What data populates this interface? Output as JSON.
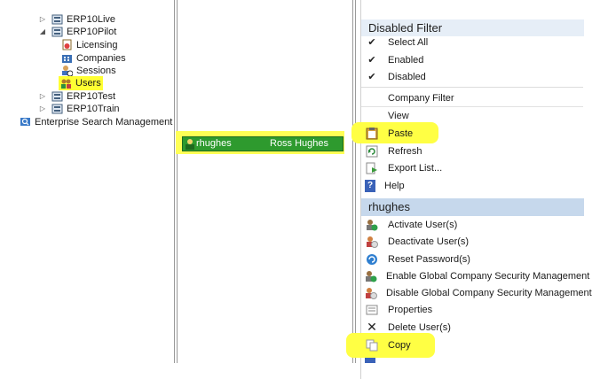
{
  "tree": {
    "items": [
      {
        "label": "ERP10Live",
        "expander": "▷"
      },
      {
        "label": "ERP10Pilot",
        "expander": "◢"
      },
      {
        "label": "Licensing"
      },
      {
        "label": "Companies"
      },
      {
        "label": "Sessions"
      },
      {
        "label": "Users"
      },
      {
        "label": "ERP10Test",
        "expander": "▷"
      },
      {
        "label": "ERP10Train",
        "expander": "▷"
      },
      {
        "label": "Enterprise Search Management"
      }
    ]
  },
  "users_list": {
    "row": {
      "login": "rhughes",
      "name": "Ross Hughes"
    }
  },
  "context_menu": {
    "filter_header": "Disabled Filter",
    "filter_items": [
      {
        "label": "Select All",
        "checked": "✔"
      },
      {
        "label": "Enabled",
        "checked": "✔"
      },
      {
        "label": "Disabled",
        "checked": "✔"
      }
    ],
    "general_items": [
      {
        "label": "Company Filter"
      },
      {
        "label": "View"
      },
      {
        "label": "Paste",
        "icon": "clipboard-icon"
      },
      {
        "label": "Refresh",
        "icon": "refresh-icon"
      },
      {
        "label": "Export List...",
        "icon": "export-icon"
      },
      {
        "label": "Help",
        "icon": "help-icon",
        "glyph": "?"
      }
    ],
    "user_header": "rhughes",
    "user_items": [
      {
        "label": "Activate User(s)",
        "icon": "activate-user-icon"
      },
      {
        "label": "Deactivate User(s)",
        "icon": "deactivate-user-icon"
      },
      {
        "label": "Reset Password(s)",
        "icon": "reset-password-icon"
      },
      {
        "label": "Enable Global Company Security Management",
        "icon": "enable-security-icon"
      },
      {
        "label": "Disable Global Company Security Management",
        "icon": "disable-security-icon"
      },
      {
        "label": "Properties",
        "icon": "properties-icon"
      },
      {
        "label": "Delete User(s)",
        "icon": "delete-icon",
        "glyph": "✕"
      },
      {
        "label": "Copy",
        "icon": "copy-icon"
      }
    ]
  },
  "colors": {
    "highlight": "#ffff33",
    "selection_green": "#2e9a2e",
    "header_blue": "#c6d8ec"
  }
}
